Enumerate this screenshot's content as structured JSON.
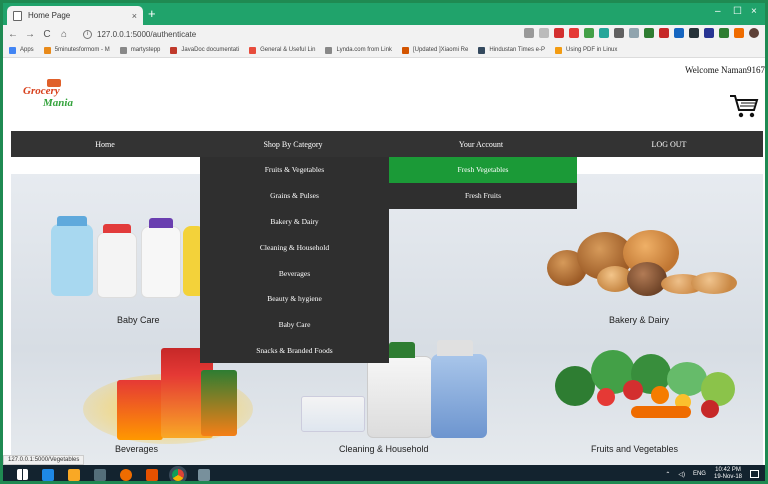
{
  "browser": {
    "tab_title": "Home Page",
    "tab_close": "×",
    "new_tab": "+",
    "url": "127.0.0.1:5000/authenticate",
    "back": "←",
    "forward": "→",
    "reload": "C",
    "home": "⌂",
    "window_min": "–",
    "window_max": "☐",
    "window_close": "×"
  },
  "bookmarks": [
    {
      "label": "Apps",
      "color": "#4285f4"
    },
    {
      "label": "5minutesformom - M",
      "color": "#e88a1a"
    },
    {
      "label": "martystepp",
      "color": "#888888"
    },
    {
      "label": "JavaDoc documentati",
      "color": "#c0392b"
    },
    {
      "label": "General & Useful Lin",
      "color": "#e74c3c"
    },
    {
      "label": "Lynda.com from Link",
      "color": "#888888"
    },
    {
      "label": "[Updated ]Xiaomi Re",
      "color": "#d35400"
    },
    {
      "label": "Hindustan Times e-P",
      "color": "#34495e"
    },
    {
      "label": "Using PDF in Linux",
      "color": "#f39c12"
    }
  ],
  "page": {
    "welcome": "Welcome Naman9167",
    "logo_line1": "Grocery",
    "logo_line2": "Mania"
  },
  "nav": {
    "home": "Home",
    "shop": "Shop By Category",
    "account": "Your Account",
    "logout": "LOG OUT"
  },
  "dropdown": [
    "Fruits & Vegetables",
    "Grains & Pulses",
    "Bakery & Dairy",
    "Cleaning & Household",
    "Beverages",
    "Beauty & hygiene",
    "Baby Care",
    "Snacks & Branded Foods"
  ],
  "submenu": [
    "Fresh Vegetables",
    "Fresh Fruits"
  ],
  "categories": {
    "baby_care": "Baby Care",
    "bakery": "Bakery & Dairy",
    "beverages": "Beverages",
    "cleaning": "Cleaning & Household",
    "fruits_veg": "Fruits and Vegetables"
  },
  "status_url": "127.0.0.1:5000/Vegetables",
  "taskbar": {
    "lang": "ENG",
    "time": "10:42 PM",
    "date": "19-Nov-18"
  },
  "colors": {
    "chrome": "#20a36b",
    "nav": "#333333",
    "active": "#1b9a37"
  }
}
